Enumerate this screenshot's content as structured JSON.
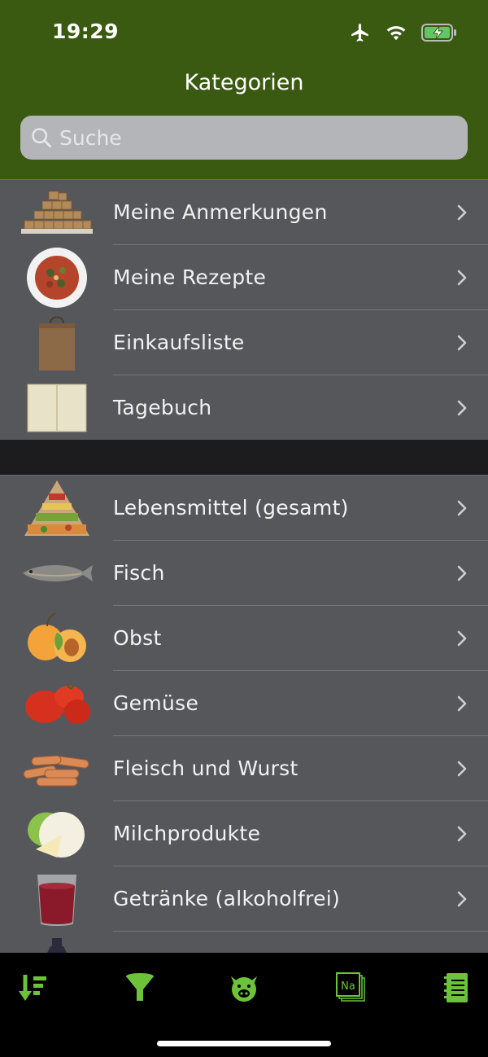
{
  "status_bar": {
    "time": "19:29"
  },
  "nav": {
    "title": "Kategorien"
  },
  "search": {
    "placeholder": "Suche"
  },
  "section1": [
    {
      "label": "Meine Anmerkungen",
      "icon": "sugar-cubes-icon"
    },
    {
      "label": "Meine Rezepte",
      "icon": "recipe-plate-icon"
    },
    {
      "label": "Einkaufsliste",
      "icon": "paper-bag-icon"
    },
    {
      "label": "Tagebuch",
      "icon": "notebook-icon"
    }
  ],
  "section2": [
    {
      "label": "Lebensmittel (gesamt)",
      "icon": "food-pyramid-icon"
    },
    {
      "label": "Fisch",
      "icon": "fish-icon"
    },
    {
      "label": "Obst",
      "icon": "apricot-icon"
    },
    {
      "label": "Gemüse",
      "icon": "tomato-icon"
    },
    {
      "label": "Fleisch und Wurst",
      "icon": "sausages-icon"
    },
    {
      "label": "Milchprodukte",
      "icon": "cheese-icon"
    },
    {
      "label": "Getränke (alkoholfrei)",
      "icon": "juice-glass-icon"
    }
  ],
  "tabbar": {
    "tabs": [
      {
        "icon": "sort-list-icon"
      },
      {
        "icon": "filter-funnel-icon"
      },
      {
        "icon": "piggy-icon"
      },
      {
        "icon": "sodium-na-icon",
        "text": "Na"
      },
      {
        "icon": "notepad-icon"
      }
    ]
  },
  "colors": {
    "header": "#3a5a12",
    "list": "#56575b",
    "accent": "#6cc33a"
  }
}
